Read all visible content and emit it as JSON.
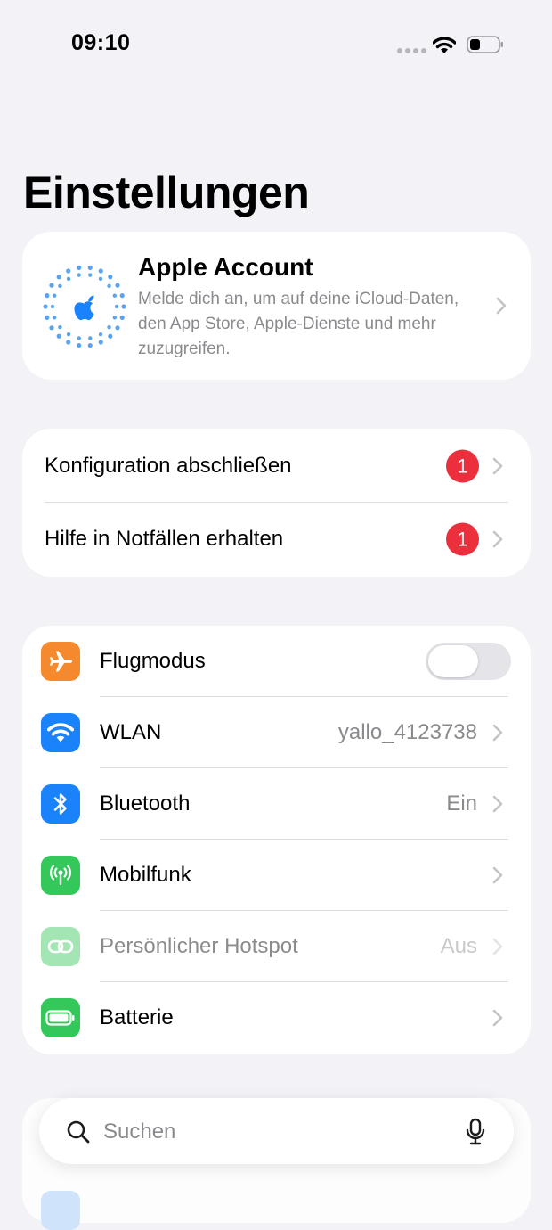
{
  "status_bar": {
    "time": "09:10"
  },
  "page_title": "Einstellungen",
  "account": {
    "title": "Apple Account",
    "subtitle": "Melde dich an, um auf deine iCloud-Daten, den App Store, Apple-Dienste und mehr zuzugreifen."
  },
  "alerts": [
    {
      "label": "Konfiguration abschließen",
      "badge": "1"
    },
    {
      "label": "Hilfe in Notfällen erhalten",
      "badge": "1"
    }
  ],
  "connectivity": [
    {
      "label": "Flugmodus",
      "icon": "airplane-icon",
      "color": "#f5892d",
      "toggle": false
    },
    {
      "label": "WLAN",
      "icon": "wifi-icon",
      "color": "#1a82fb",
      "value": "yallo_4123738"
    },
    {
      "label": "Bluetooth",
      "icon": "bluetooth-icon",
      "color": "#1a82fb",
      "value": "Ein"
    },
    {
      "label": "Mobilfunk",
      "icon": "antenna-icon",
      "color": "#34c759"
    },
    {
      "label": "Persönlicher Hotspot",
      "icon": "hotspot-link-icon",
      "color": "#34c759",
      "value": "Aus",
      "dimmed": true
    },
    {
      "label": "Batterie",
      "icon": "battery-icon",
      "color": "#34c759"
    }
  ],
  "search": {
    "placeholder": "Suchen"
  },
  "colors": {
    "accent": "#1a82fb",
    "badge": "#eb2f3c",
    "background": "#f2f2f7"
  }
}
